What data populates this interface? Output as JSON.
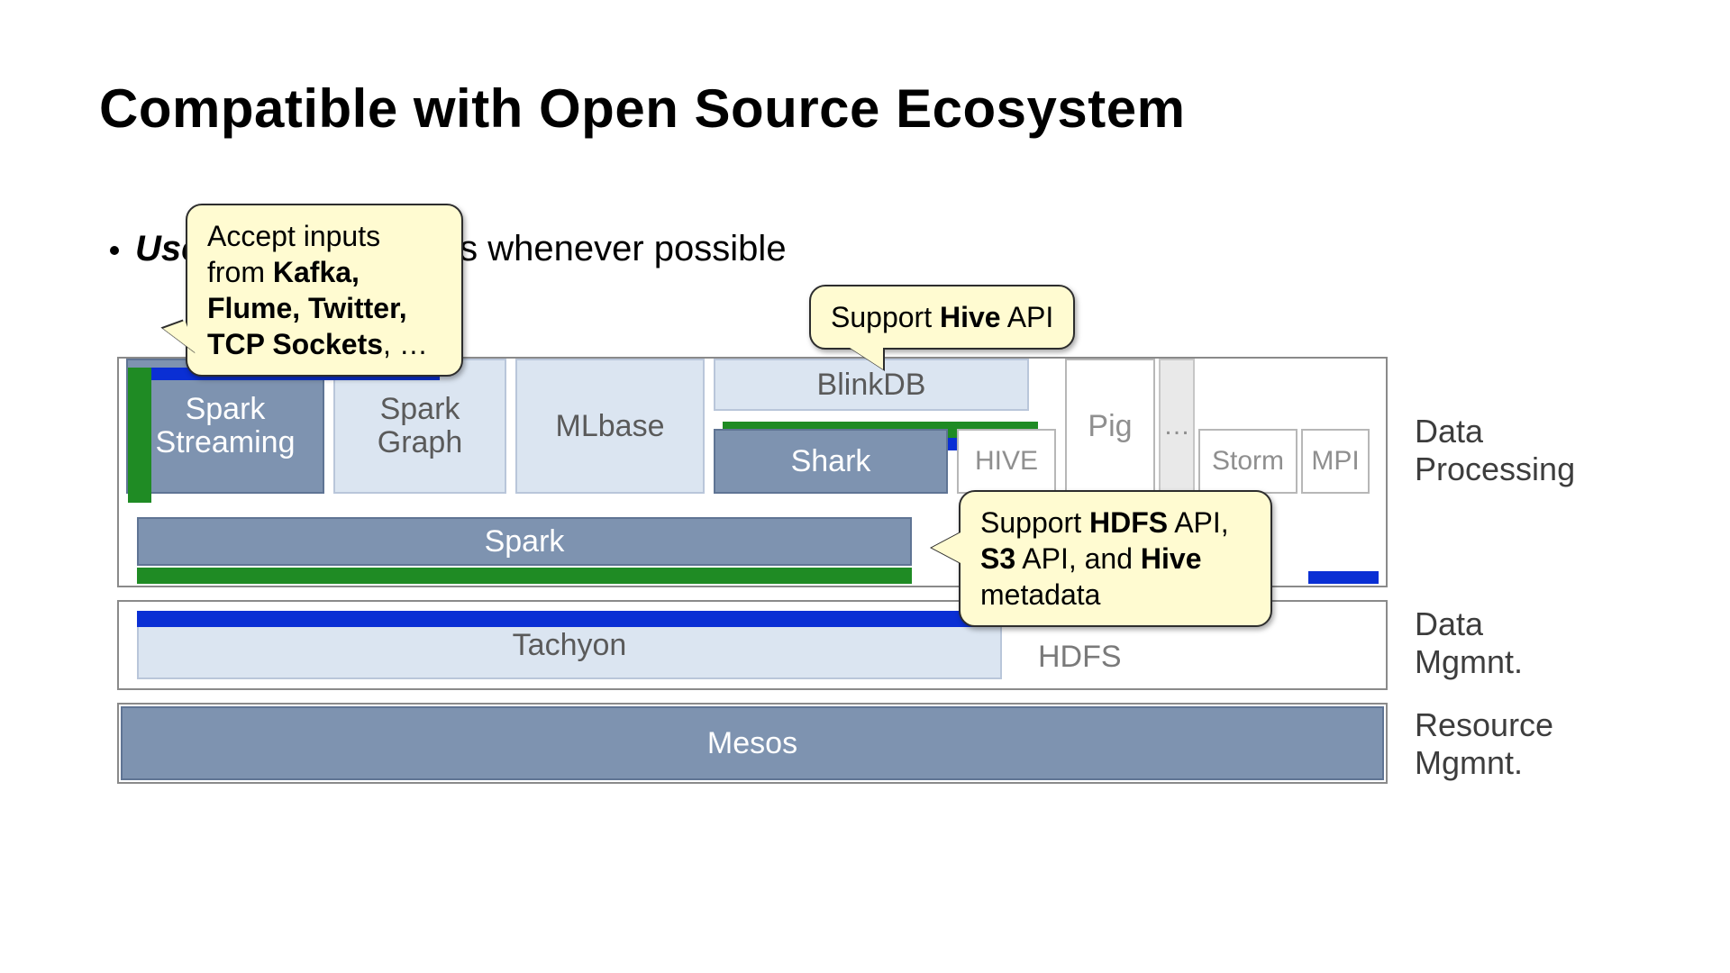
{
  "title": "Compatible with Open Source Ecosystem",
  "bullet": {
    "use": "Use",
    "rest": "ces whenever possible"
  },
  "callouts": {
    "inputs": {
      "line1": "Accept inputs",
      "line2_a": "from ",
      "line2_b": "Kafka,",
      "line3": "Flume, Twitter,",
      "line4_b": "TCP Sockets",
      "line4_rest": ", …"
    },
    "hive": {
      "pre": "Support ",
      "b": "Hive",
      "post": " API"
    },
    "hdfs": {
      "l1_pre": "Support ",
      "l1_b": "HDFS",
      "l1_post": " API,",
      "l2_b": "S3",
      "l2_mid": " API, and ",
      "l2_b2": "Hive",
      "l3": "metadata"
    }
  },
  "boxes": {
    "spark_streaming_l1": "Spark",
    "spark_streaming_l2": "Streaming",
    "spark_graph_l1": "Spark",
    "spark_graph_l2": "Graph",
    "mlbase": "MLbase",
    "blinkdb": "BlinkDB",
    "shark": "Shark",
    "hive": "HIVE",
    "pig": "Pig",
    "ellipsis": "…",
    "storm": "Storm",
    "mpi": "MPI",
    "spark": "Spark",
    "tachyon": "Tachyon",
    "hdfs": "HDFS",
    "mesos": "Mesos"
  },
  "labels": {
    "data_processing_l1": "Data",
    "data_processing_l2": "Processing",
    "data_mgmt_l1": "Data",
    "data_mgmt_l2": "Mgmnt.",
    "resource_l1": "Resource",
    "resource_l2": "Mgmnt."
  }
}
